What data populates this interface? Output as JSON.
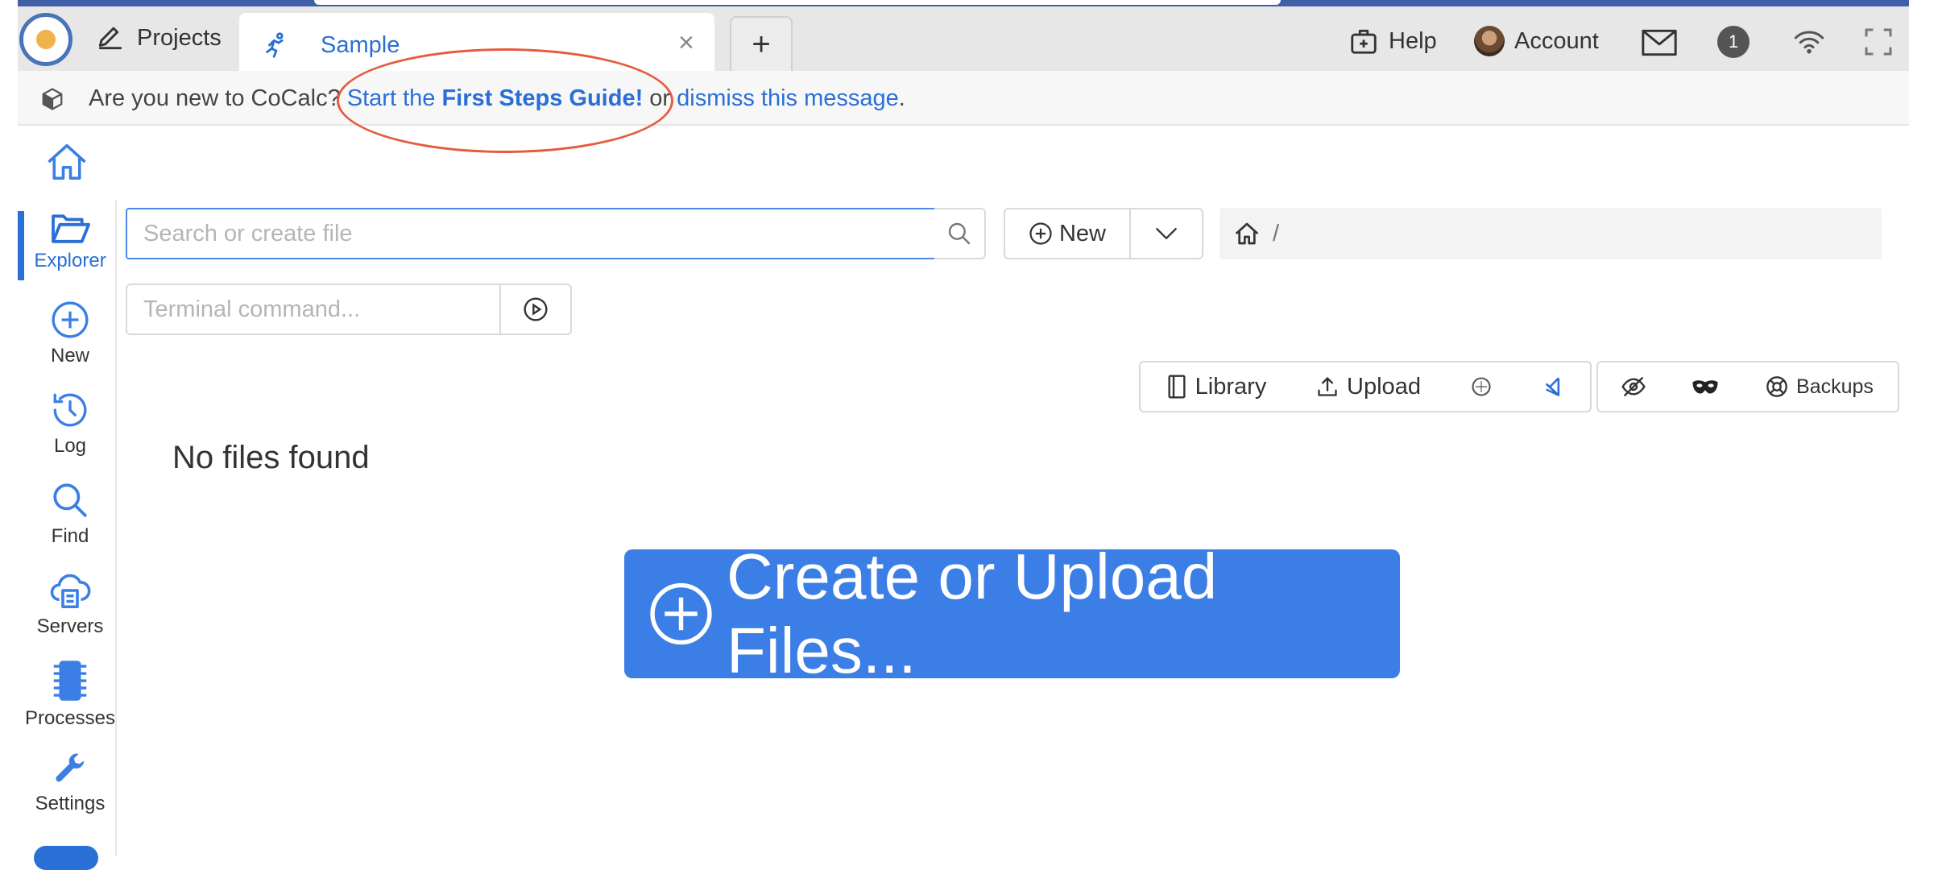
{
  "nav": {
    "projects_label": "Projects",
    "tab_label": "Sample",
    "tab_close": "×",
    "new_tab": "+",
    "help_label": "Help",
    "account_label": "Account",
    "notification_count": "1"
  },
  "banner": {
    "question": "Are you new to CoCalc?",
    "start_prefix": "Start the",
    "start_bold": "First Steps Guide!",
    "or_text": "or",
    "dismiss": "dismiss this message",
    "period": "."
  },
  "sidebar": {
    "items": [
      {
        "label": "Explorer"
      },
      {
        "label": "New"
      },
      {
        "label": "Log"
      },
      {
        "label": "Find"
      },
      {
        "label": "Servers"
      },
      {
        "label": "Processes"
      },
      {
        "label": "Settings"
      }
    ]
  },
  "explorer": {
    "search_placeholder": "Search or create file",
    "new_label": "New",
    "path_root": "/",
    "terminal_placeholder": "Terminal command...",
    "no_files": "No files found",
    "create_label": "Create or Upload Files..."
  },
  "toolbar": {
    "library": "Library",
    "upload": "Upload",
    "backups": "Backups"
  },
  "colors": {
    "accent": "#2a6fd6",
    "primary_button": "#3b7fe6",
    "annotation": "#e55b3f"
  }
}
